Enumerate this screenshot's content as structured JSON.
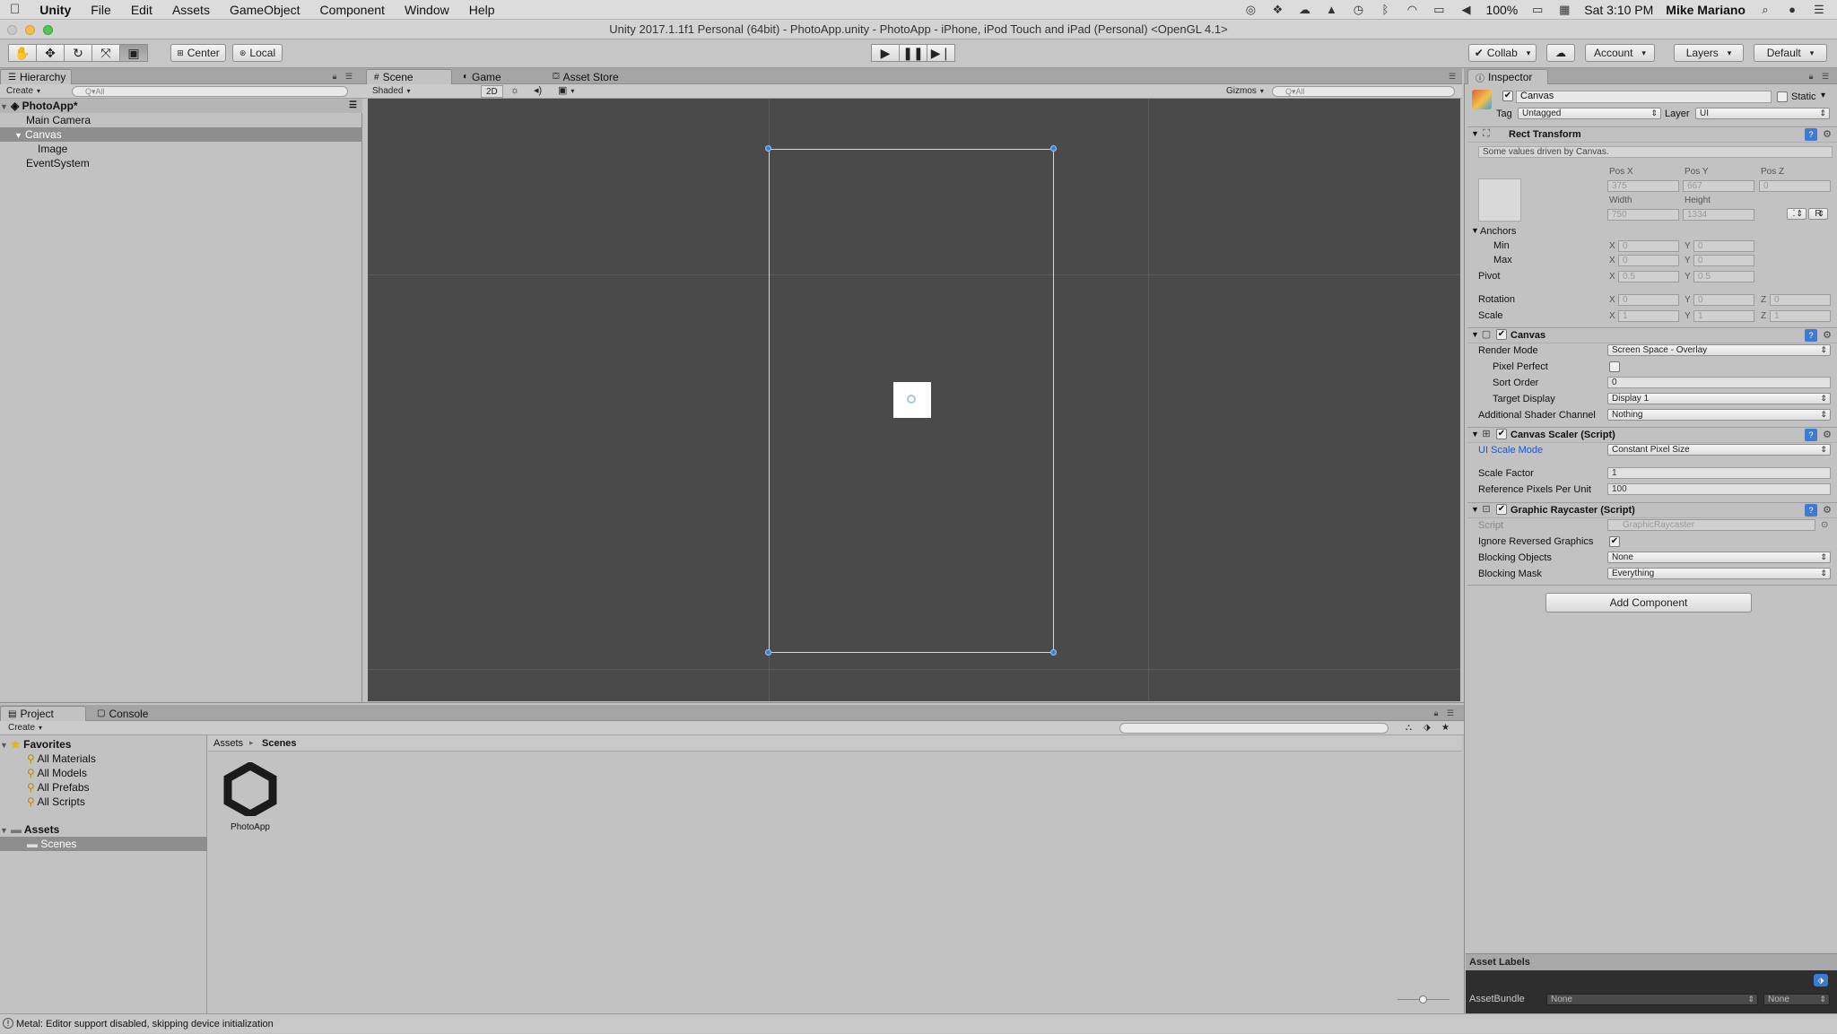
{
  "menubar": {
    "app": "Unity",
    "items": [
      "File",
      "Edit",
      "Assets",
      "GameObject",
      "Component",
      "Window",
      "Help"
    ],
    "battery": "100%",
    "clock": "Sat 3:10 PM",
    "user": "Mike Mariano"
  },
  "window": {
    "title": "Unity 2017.1.1f1 Personal (64bit) - PhotoApp.unity - PhotoApp - iPhone, iPod Touch and iPad (Personal) <OpenGL 4.1>"
  },
  "toolbar": {
    "pivot": "Center",
    "space": "Local",
    "collab": "Collab",
    "account": "Account",
    "layers": "Layers",
    "layout": "Default"
  },
  "hierarchy": {
    "tab": "Hierarchy",
    "create": "Create",
    "search_placeholder": "Q▾All",
    "scene": "PhotoApp*",
    "items": [
      "Main Camera",
      "Canvas",
      "Image",
      "EventSystem"
    ]
  },
  "scene_view": {
    "tabs": [
      "Scene",
      "Game",
      "Asset Store"
    ],
    "shading": "Shaded",
    "mode2d": "2D",
    "gizmos": "Gizmos",
    "search_placeholder": "Q▾All"
  },
  "inspector": {
    "tab": "Inspector",
    "object_name": "Canvas",
    "static_label": "Static",
    "tag_label": "Tag",
    "tag_value": "Untagged",
    "layer_label": "Layer",
    "layer_value": "UI",
    "rect": {
      "title": "Rect Transform",
      "note": "Some values driven by Canvas.",
      "posx_label": "Pos X",
      "posy_label": "Pos Y",
      "posz_label": "Pos Z",
      "posx": "375",
      "posy": "667",
      "posz": "0",
      "width_label": "Width",
      "height_label": "Height",
      "width": "750",
      "height": "1334",
      "r_button": "R",
      "anchors": "Anchors",
      "min": "Min",
      "max": "Max",
      "min_x": "0",
      "min_y": "0",
      "max_x": "0",
      "max_y": "0",
      "pivot": "Pivot",
      "pivot_x": "0.5",
      "pivot_y": "0.5",
      "rotation": "Rotation",
      "rot_x": "0",
      "rot_y": "0",
      "rot_z": "0",
      "scale": "Scale",
      "scale_x": "1",
      "scale_y": "1",
      "scale_z": "1",
      "axis_x": "X",
      "axis_y": "Y",
      "axis_z": "Z"
    },
    "canvas": {
      "title": "Canvas",
      "render_mode_label": "Render Mode",
      "render_mode": "Screen Space - Overlay",
      "pixel_perfect_label": "Pixel Perfect",
      "sort_order_label": "Sort Order",
      "sort_order": "0",
      "target_display_label": "Target Display",
      "target_display": "Display 1",
      "shader_channel_label": "Additional Shader Channel",
      "shader_channel": "Nothing"
    },
    "scaler": {
      "title": "Canvas Scaler (Script)",
      "mode_label": "UI Scale Mode",
      "mode": "Constant Pixel Size",
      "factor_label": "Scale Factor",
      "factor": "1",
      "ppu_label": "Reference Pixels Per Unit",
      "ppu": "100"
    },
    "raycaster": {
      "title": "Graphic Raycaster (Script)",
      "script_label": "Script",
      "script": "GraphicRaycaster",
      "ignore_label": "Ignore Reversed Graphics",
      "blocking_objects_label": "Blocking Objects",
      "blocking_objects": "None",
      "blocking_mask_label": "Blocking Mask",
      "blocking_mask": "Everything"
    },
    "add_component": "Add Component",
    "asset_labels": "Asset Labels",
    "asset_bundle_label": "AssetBundle",
    "asset_bundle": "None",
    "asset_variant": "None"
  },
  "project": {
    "tabs": [
      "Project",
      "Console"
    ],
    "create": "Create",
    "favorites": "Favorites",
    "favorite_items": [
      "All Materials",
      "All Models",
      "All Prefabs",
      "All Scripts"
    ],
    "assets": "Assets",
    "scenes": "Scenes",
    "breadcrumb": [
      "Assets",
      "Scenes"
    ],
    "file": "PhotoApp"
  },
  "status": "Metal: Editor support disabled, skipping device initialization"
}
